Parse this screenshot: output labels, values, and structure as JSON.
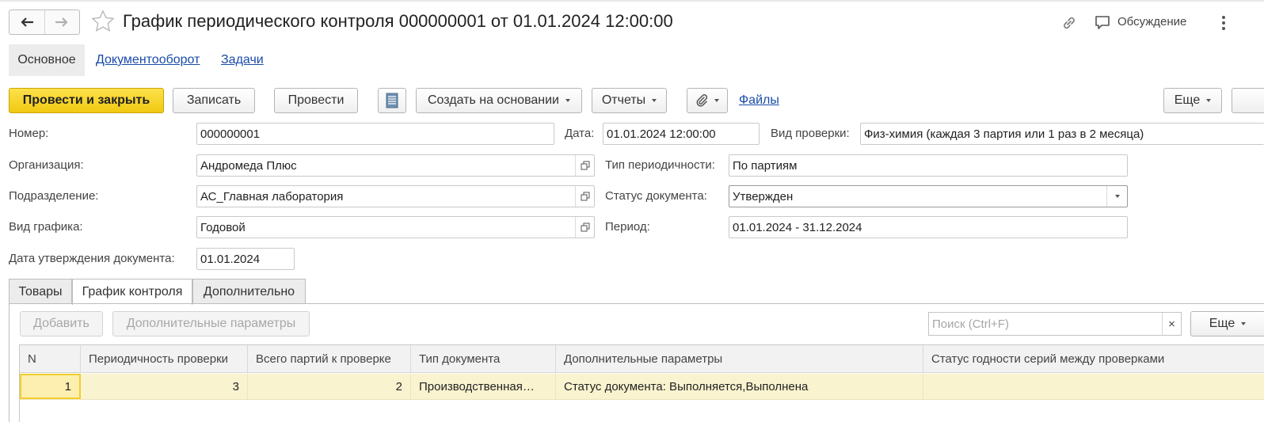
{
  "window": {
    "title": "График периодического контроля 000000001 от 01.01.2024 12:00:00",
    "discussion_label": "Обсуждение"
  },
  "tabs": {
    "main": "Основное",
    "docflow": "Документооборот",
    "tasks": "Задачи"
  },
  "toolbar": {
    "post_and_close": "Провести и закрыть",
    "save": "Записать",
    "post": "Провести",
    "create_based_on": "Создать на основании",
    "reports": "Отчеты",
    "files": "Файлы",
    "more": "Еще"
  },
  "form": {
    "number_label": "Номер:",
    "number_value": "000000001",
    "date_label": "Дата:",
    "date_value": "01.01.2024 12:00:00",
    "check_type_label": "Вид проверки:",
    "check_type_value": "Физ-химия (каждая 3 партия или 1 раз в 2 месяца)",
    "org_label": "Организация:",
    "org_value": "Андромеда Плюс",
    "periodicity_type_label": "Тип периодичности:",
    "periodicity_type_value": "По партиям",
    "division_label": "Подразделение:",
    "division_value": "АС_Главная лаборатория",
    "doc_status_label": "Статус документа:",
    "doc_status_value": "Утвержден",
    "schedule_type_label": "Вид графика:",
    "schedule_type_value": "Годовой",
    "period_label": "Период:",
    "period_value": "01.01.2024 - 31.12.2024",
    "approval_date_label": "Дата утверждения документа:",
    "approval_date_value": "01.01.2024"
  },
  "form_tabs": [
    "Товары",
    "График контроля",
    "Дополнительно"
  ],
  "table_toolbar": {
    "add": "Добавить",
    "extra_params": "Дополнительные параметры",
    "search_placeholder": "Поиск (Ctrl+F)",
    "clear": "×",
    "more": "Еще"
  },
  "table": {
    "columns": [
      "N",
      "Периодичность проверки",
      "Всего партий к проверке",
      "Тип документа",
      "Дополнительные параметры",
      "Статус годности серий между проверками"
    ],
    "rows": [
      [
        "1",
        "3",
        "2",
        "Производственная…",
        "Статус документа: Выполняется,Выполнена",
        ""
      ]
    ]
  },
  "colors": {
    "primary_button": "#f5d326",
    "link": "#1a4ba8",
    "selected_row": "#faf3cf"
  },
  "icons": [
    "back-arrow-icon",
    "forward-arrow-icon",
    "favorite-star-icon",
    "link-icon",
    "discussion-icon",
    "more-vertical-icon",
    "document-list-icon",
    "paperclip-icon",
    "open-icon",
    "dropdown-icon"
  ]
}
